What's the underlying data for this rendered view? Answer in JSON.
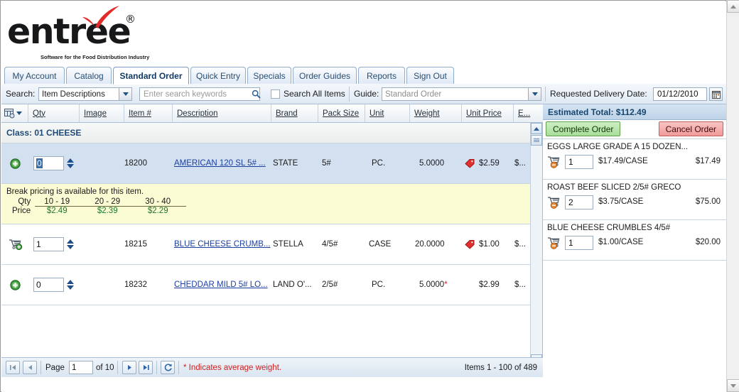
{
  "brand": {
    "name": "entree",
    "registered": "®",
    "tagline": "Software for the Food Distribution Industry"
  },
  "tabs": [
    {
      "label": "My Account",
      "active": false
    },
    {
      "label": "Catalog",
      "active": false
    },
    {
      "label": "Standard Order",
      "active": true
    },
    {
      "label": "Quick Entry",
      "active": false
    },
    {
      "label": "Specials",
      "active": false
    },
    {
      "label": "Order Guides",
      "active": false
    },
    {
      "label": "Reports",
      "active": false
    },
    {
      "label": "Sign Out",
      "active": false
    }
  ],
  "search": {
    "label": "Search:",
    "field_selected": "Item Descriptions",
    "keywords_placeholder": "Enter search keywords",
    "keywords_value": "",
    "search_all_label": "Search All Items",
    "search_all_checked": false,
    "guide_label": "Guide:",
    "guide_selected": "Standard Order",
    "delivery_label": "Requested Delivery Date:",
    "delivery_value": "01/12/2010",
    "icons": {
      "magnifier": "search-icon",
      "calendar": "calendar-icon",
      "dropdown": "chevron-down-icon"
    }
  },
  "grid": {
    "columns": [
      {
        "key": "qty",
        "label": "Qty"
      },
      {
        "key": "image",
        "label": "Image"
      },
      {
        "key": "item",
        "label": "Item #"
      },
      {
        "key": "description",
        "label": "Description"
      },
      {
        "key": "brand",
        "label": "Brand"
      },
      {
        "key": "pack",
        "label": "Pack Size"
      },
      {
        "key": "unit",
        "label": "Unit"
      },
      {
        "key": "weight",
        "label": "Weight"
      },
      {
        "key": "price",
        "label": "Unit Price"
      },
      {
        "key": "ext",
        "label": "E..."
      }
    ],
    "class_header": "Class: 01 CHEESE",
    "rows": [
      {
        "type": "item",
        "selected": true,
        "action_icon": "add-item-icon",
        "qty": "0",
        "qty_selected": true,
        "item_number": "18200",
        "description": "AMERICAN 120 SL 5# ...",
        "brand": "STATE",
        "pack_size": "5#",
        "unit": "PC.",
        "weight": "5.0000",
        "weight_avg": false,
        "has_price_tag": true,
        "unit_price": "$2.59",
        "extended": "$..."
      },
      {
        "type": "break_pricing",
        "title": "Break pricing is available for this item.",
        "qty_label": "Qty",
        "price_label": "Price",
        "tiers": [
          {
            "qty": "10 - 19",
            "price": "$2.49"
          },
          {
            "qty": "20 - 29",
            "price": "$2.39"
          },
          {
            "qty": "30 - 40",
            "price": "$2.29"
          }
        ]
      },
      {
        "type": "item",
        "selected": false,
        "action_icon": "cart-add-icon",
        "qty": "1",
        "qty_selected": false,
        "item_number": "18215",
        "description": "BLUE CHEESE CRUMB...",
        "brand": "STELLA",
        "pack_size": "4/5#",
        "unit": "CASE",
        "weight": "20.0000",
        "weight_avg": false,
        "has_price_tag": true,
        "unit_price": "$1.00",
        "extended": "$..."
      },
      {
        "type": "item",
        "selected": false,
        "action_icon": "add-item-icon",
        "qty": "0",
        "qty_selected": false,
        "item_number": "18232",
        "description": "CHEDDAR MILD 5# LO...",
        "brand": "LAND O'...",
        "pack_size": "2/5#",
        "unit": "PC.",
        "weight": "5.0000",
        "weight_avg": true,
        "has_price_tag": false,
        "unit_price": "$2.99",
        "extended": "$..."
      }
    ]
  },
  "cart": {
    "total_label": "Estimated Total: $112.49",
    "complete_label": "Complete Order",
    "cancel_label": "Cancel Order",
    "items": [
      {
        "name": "EGGS LARGE GRADE A 15 DOZEN...",
        "qty": "1",
        "unit_price": "$17.49/CASE",
        "extended": "$17.49",
        "icon": "cart-remove-icon"
      },
      {
        "name": "ROAST BEEF SLICED 2/5# GRECO",
        "qty": "2",
        "unit_price": "$3.75/CASE",
        "extended": "$75.00",
        "icon": "cart-remove-icon"
      },
      {
        "name": "BLUE CHEESE CRUMBLES 4/5#",
        "qty": "1",
        "unit_price": "$1.00/CASE",
        "extended": "$20.00",
        "icon": "cart-remove-icon"
      }
    ]
  },
  "footer": {
    "page_label": "Page",
    "page_value": "1",
    "of_label": "of 10",
    "note": "* Indicates average weight.",
    "items_range": "Items 1 - 100 of 489",
    "buttons": {
      "first": "first-page-button",
      "prev": "prev-page-button",
      "next": "next-page-button",
      "last": "last-page-button",
      "refresh": "refresh-button"
    }
  },
  "colors": {
    "accent": "#1f4b78",
    "link": "#1a3fa0",
    "price_tag": "#e03030",
    "break_bg": "#fbfbd4",
    "selected_row": "#d3e0f0",
    "complete": "#a8dd99",
    "cancel": "#f09a9a",
    "note": "#cc2222",
    "break_price": "#1a7a2a"
  }
}
